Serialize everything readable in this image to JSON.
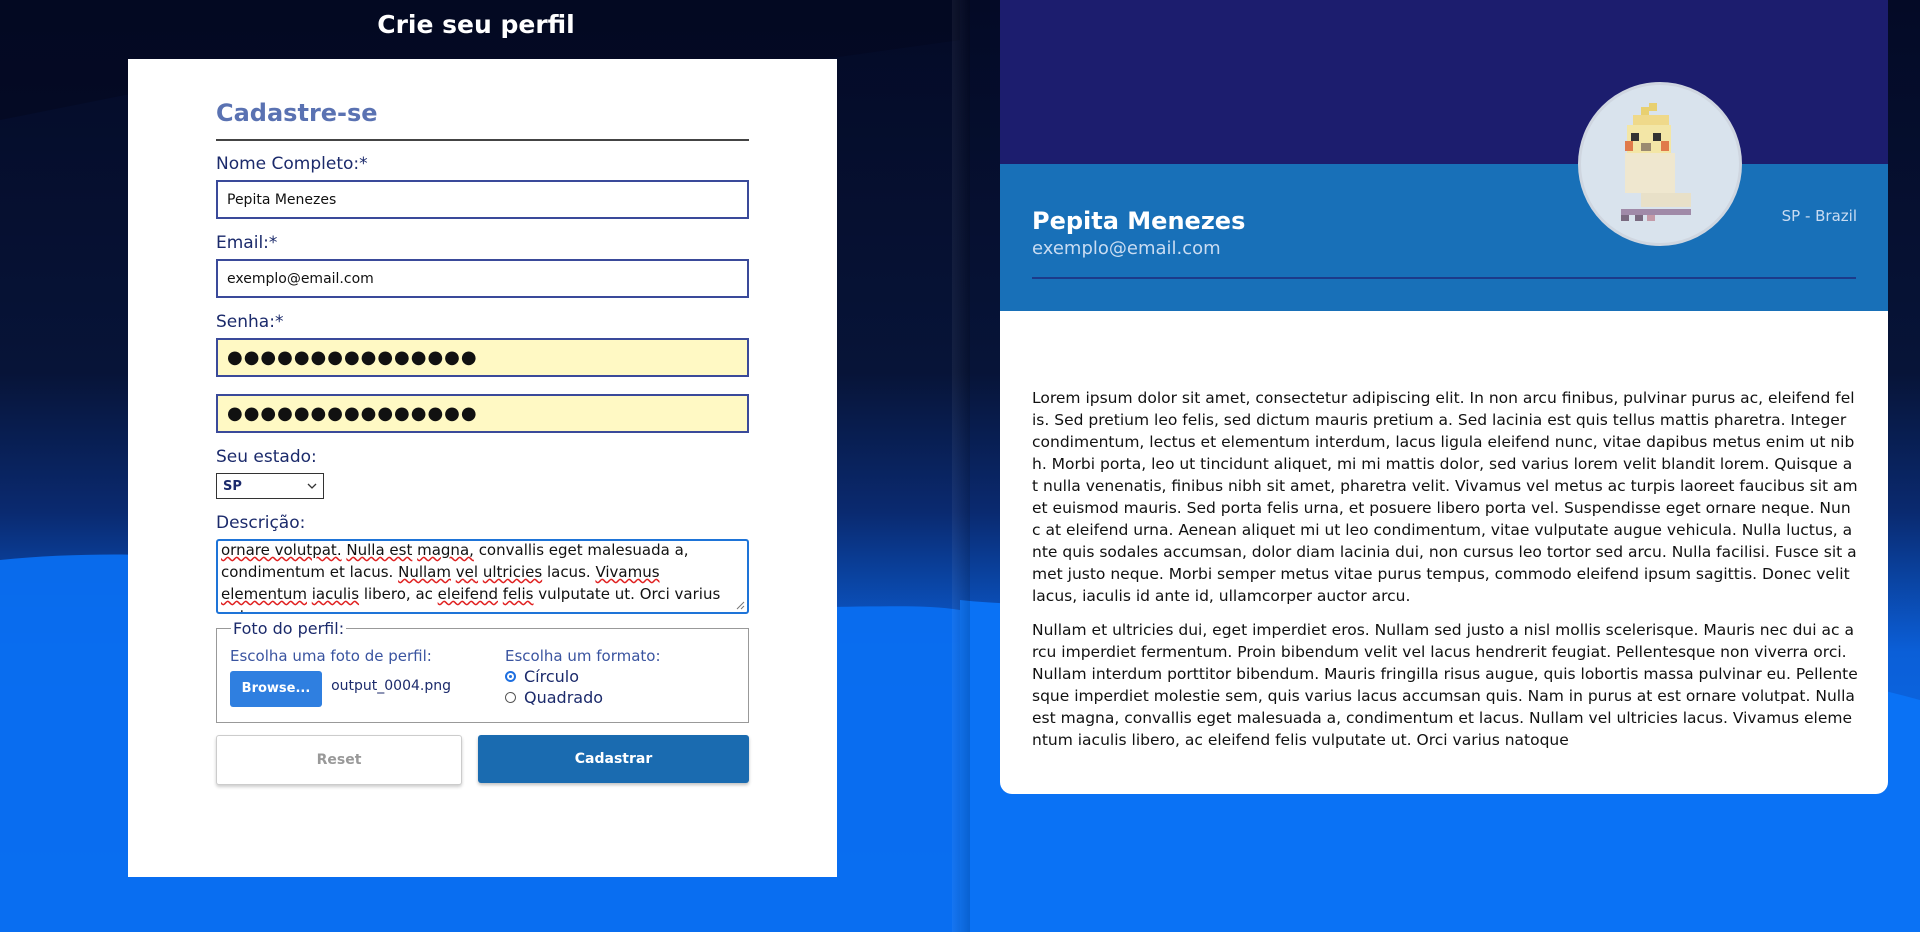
{
  "page": {
    "title": "Crie seu perfil"
  },
  "form": {
    "heading": "Cadastre-se",
    "name_label": "Nome Completo:*",
    "name_value": "Pepita Menezes",
    "email_label": "Email:*",
    "email_value": "exemplo@email.com",
    "password_label": "Senha:*",
    "password_masked": "●●●●●●●●●●●●●●●",
    "password_confirm_masked": "●●●●●●●●●●●●●●●",
    "state_label": "Seu estado:",
    "state_value": "SP",
    "description_label": "Descrição:",
    "description_visible": [
      "ornare volutpat.",
      "Nulla est",
      "magna,",
      "convallis eget malesuada a,",
      "condimentum et lacus.",
      "Nullam",
      "vel",
      "ultricies",
      "lacus.",
      "Vivamus",
      "elementum",
      "iaculis",
      "libero, ac",
      "eleifend",
      "felis",
      "vulputate ut.",
      "Orci varius",
      "natoque"
    ],
    "photo_legend": "Foto do perfil:",
    "photo_choose_label": "Escolha uma foto de perfil:",
    "browse_label": "Browse...",
    "file_name": "output_0004.png",
    "format_label": "Escolha um formato:",
    "format_options": [
      "Círculo",
      "Quadrado"
    ],
    "format_selected": "Círculo",
    "reset_label": "Reset",
    "submit_label": "Cadastrar"
  },
  "profile": {
    "name": "Pepita Menezes",
    "email": "exemplo@email.com",
    "location": "SP - Brazil",
    "paragraphs": [
      "Lorem ipsum dolor sit amet, consectetur adipiscing elit. In non arcu finibus, pulvinar purus ac, eleifend felis. Sed pretium leo felis, sed dictum mauris pretium a. Sed lacinia est quis tellus mattis pharetra. Integer condimentum, lectus et elementum interdum, lacus ligula eleifend nunc, vitae dapibus metus enim ut nibh. Morbi porta, leo ut tincidunt aliquet, mi mi mattis dolor, sed varius lorem velit blandit lorem. Quisque at nulla venenatis, finibus nibh sit amet, pharetra velit. Vivamus vel metus ac turpis laoreet faucibus sit amet euismod mauris. Sed porta felis urna, et posuere libero porta vel. Suspendisse eget ornare neque. Nunc at eleifend urna. Aenean aliquet mi ut leo condimentum, vitae vulputate augue vehicula. Nulla luctus, ante quis sodales accumsan, dolor diam lacinia dui, non cursus leo tortor sed arcu. Nulla facilisi. Fusce sit amet justo neque. Morbi semper metus vitae purus tempus, commodo eleifend ipsum sagittis. Donec velit lacus, iaculis id ante id, ullamcorper auctor arcu.",
      "Nullam et ultricies dui, eget imperdiet eros. Nullam sed justo a nisl mollis scelerisque. Mauris nec dui ac arcu imperdiet fermentum. Proin bibendum velit vel lacus hendrerit feugiat. Pellentesque non viverra orci. Nullam interdum porttitor bibendum. Mauris fringilla risus augue, quis lobortis massa pulvinar eu. Pellentesque imperdiet molestie sem, quis varius lacus accumsan quis. Nam in purus at est ornare volutpat. Nulla est magna, convallis eget malesuada a, condimentum et lacus. Nullam vel ultricies lacus. Vivamus elementum iaculis libero, ac eleifend felis vulputate ut. Orci varius natoque"
    ]
  },
  "colors": {
    "accent": "#1a6bb0",
    "header_dark": "#1c1d6e",
    "header_band": "#1870b8",
    "browse": "#2f7fe0"
  }
}
